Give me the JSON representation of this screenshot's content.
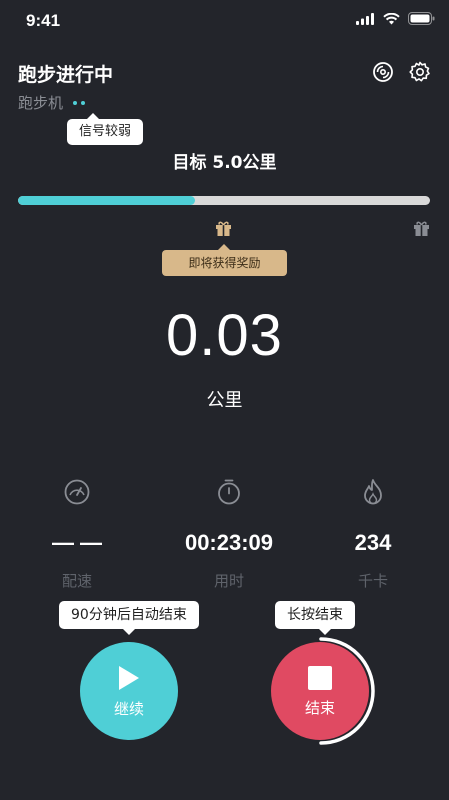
{
  "status_bar": {
    "time": "9:41"
  },
  "header": {
    "title": "跑步进行中",
    "device": "跑步机",
    "signal_tooltip": "信号较弱"
  },
  "goal": {
    "text": "目标 5.0公里",
    "progress": 0.43
  },
  "reward": {
    "text": "即将获得奖励"
  },
  "distance": {
    "value": "0.03",
    "unit": "公里"
  },
  "stats": [
    {
      "icon": "speedometer-icon",
      "value": "— —",
      "label": "配速"
    },
    {
      "icon": "stopwatch-icon",
      "value": "00:23:09",
      "label": "用时"
    },
    {
      "icon": "flame-icon",
      "value": "234",
      "label": "千卡"
    }
  ],
  "continue_button": {
    "label": "继续",
    "tooltip": "90分钟后自动结束"
  },
  "end_button": {
    "label": "结束",
    "tooltip": "长按结束"
  },
  "colors": {
    "background": "#23252b",
    "accent": "#4fcfd6",
    "end": "#e04a62",
    "reward": "#d8b88a"
  }
}
